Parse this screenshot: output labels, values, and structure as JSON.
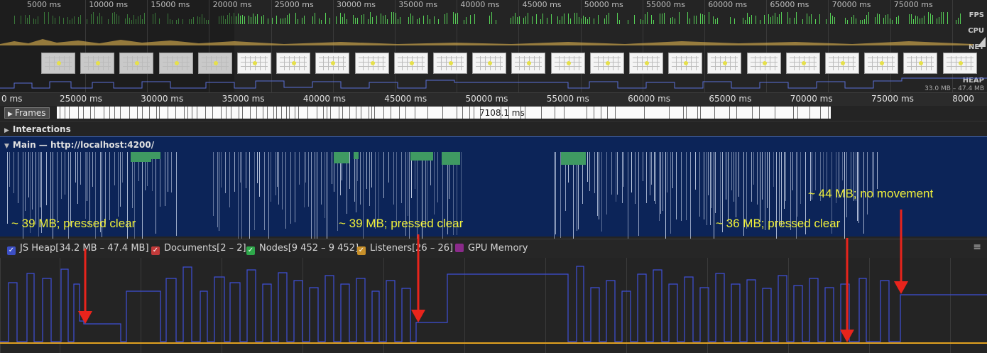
{
  "overview": {
    "ticks": [
      "5000 ms",
      "10000 ms",
      "15000 ms",
      "20000 ms",
      "25000 ms",
      "30000 ms",
      "35000 ms",
      "40000 ms",
      "45000 ms",
      "50000 ms",
      "55000 ms",
      "60000 ms",
      "65000 ms",
      "70000 ms",
      "75000 ms"
    ],
    "tracks": {
      "fps": "FPS",
      "cpu": "CPU",
      "net": "NET",
      "heap": "HEAP"
    },
    "heap_range": "33.0 MB – 47.4 MB"
  },
  "ruler": {
    "ticks": [
      "0 ms",
      "25000 ms",
      "30000 ms",
      "35000 ms",
      "40000 ms",
      "45000 ms",
      "50000 ms",
      "55000 ms",
      "60000 ms",
      "65000 ms",
      "70000 ms",
      "75000 ms",
      "8000"
    ]
  },
  "frames": {
    "label": "Frames",
    "duration": "7108.1 ms"
  },
  "interactions": {
    "label": "Interactions"
  },
  "main": {
    "label": "Main — http://localhost:4200/"
  },
  "annotations": [
    "~ 39 MB; pressed clear",
    "~ 39 MB; pressed clear",
    "~ 36 MB; pressed clear",
    "~ 44 MB; no movement"
  ],
  "legend": [
    {
      "label": "JS Heap[34.2 MB – 47.4 MB]",
      "color": "#3c4fc4",
      "checked": true
    },
    {
      "label": "Documents[2 – 2]",
      "color": "#c23a3a",
      "checked": true
    },
    {
      "label": "Nodes[9 452 – 9 452]",
      "color": "#2ea84a",
      "checked": true
    },
    {
      "label": "Listeners[26 – 26]",
      "color": "#c8902a",
      "checked": true
    },
    {
      "label": "GPU Memory",
      "color": "#8a2a8a",
      "checked": false
    }
  ],
  "colors": {
    "heap_line": "#3f4fd8",
    "listeners_line": "#e0a020",
    "arrow": "#e8241c",
    "annotation": "#f0f03a",
    "main_bg": "#0c2458"
  },
  "icons": {
    "menu": "hamburger-menu-icon",
    "expand": "triangle-right-icon",
    "collapse": "triangle-down-icon"
  }
}
